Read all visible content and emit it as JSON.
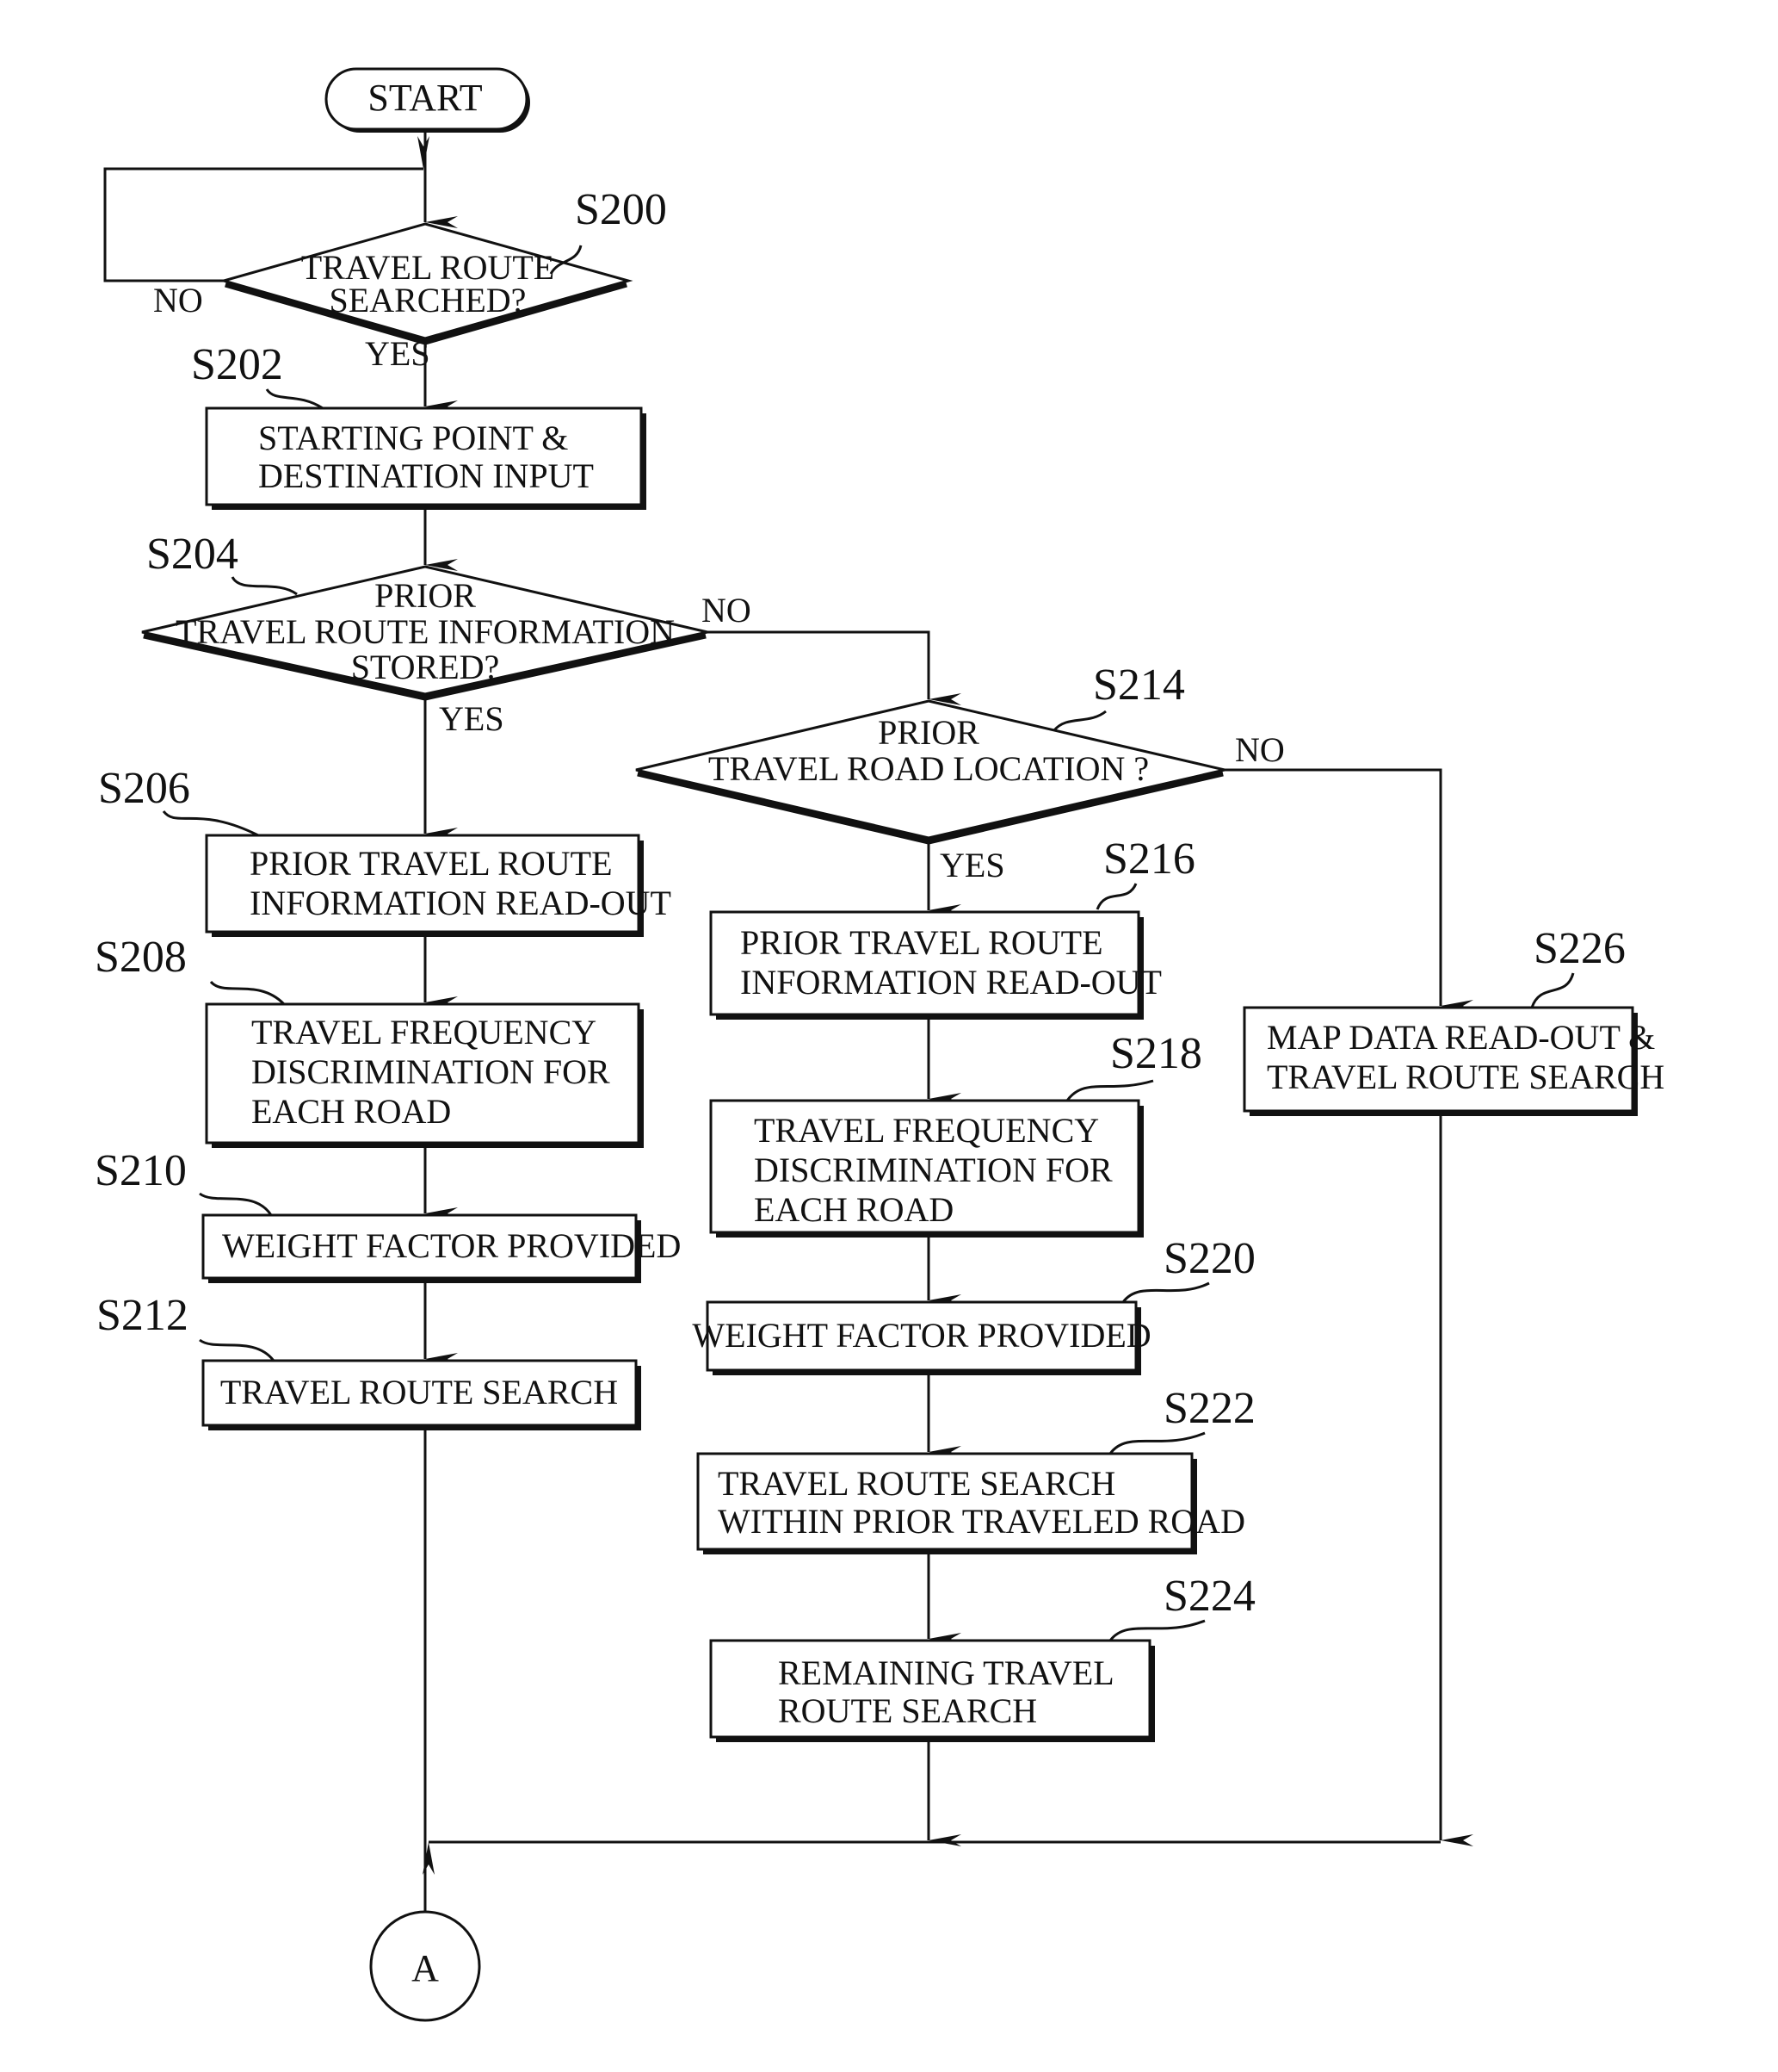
{
  "figure": {
    "terminals": {
      "start": "START",
      "connector": "A"
    },
    "decisions": [
      {
        "id": "S200",
        "lines": [
          "TRAVEL ROUTE",
          "SEARCHED?"
        ],
        "yes": "YES",
        "no": "NO"
      },
      {
        "id": "S204",
        "lines": [
          "PRIOR",
          "TRAVEL ROUTE INFORMATION",
          "STORED?"
        ],
        "yes": "YES",
        "no": "NO"
      },
      {
        "id": "S214",
        "lines": [
          "PRIOR",
          "TRAVEL ROAD LOCATION ?"
        ],
        "yes": "YES",
        "no": "NO"
      }
    ],
    "processes": [
      {
        "id": "S202",
        "lines": [
          "STARTING POINT &",
          "DESTINATION INPUT"
        ]
      },
      {
        "id": "S206",
        "lines": [
          "PRIOR TRAVEL ROUTE",
          "INFORMATION READ-OUT"
        ]
      },
      {
        "id": "S208",
        "lines": [
          "TRAVEL FREQUENCY",
          "DISCRIMINATION FOR",
          "EACH ROAD"
        ]
      },
      {
        "id": "S210",
        "lines": [
          "WEIGHT FACTOR PROVIDED"
        ]
      },
      {
        "id": "S212",
        "lines": [
          "TRAVEL ROUTE SEARCH"
        ]
      },
      {
        "id": "S216",
        "lines": [
          "PRIOR TRAVEL ROUTE",
          "INFORMATION READ-OUT"
        ]
      },
      {
        "id": "S218",
        "lines": [
          "TRAVEL FREQUENCY",
          "DISCRIMINATION FOR",
          "EACH ROAD"
        ]
      },
      {
        "id": "S220",
        "lines": [
          "WEIGHT FACTOR PROVIDED"
        ]
      },
      {
        "id": "S222",
        "lines": [
          "TRAVEL ROUTE SEARCH",
          "WITHIN PRIOR TRAVELED ROAD"
        ]
      },
      {
        "id": "S224",
        "lines": [
          "REMAINING TRAVEL",
          "ROUTE SEARCH"
        ]
      },
      {
        "id": "S226",
        "lines": [
          "MAP DATA READ-OUT &",
          "TRAVEL ROUTE SEARCH"
        ]
      }
    ]
  }
}
